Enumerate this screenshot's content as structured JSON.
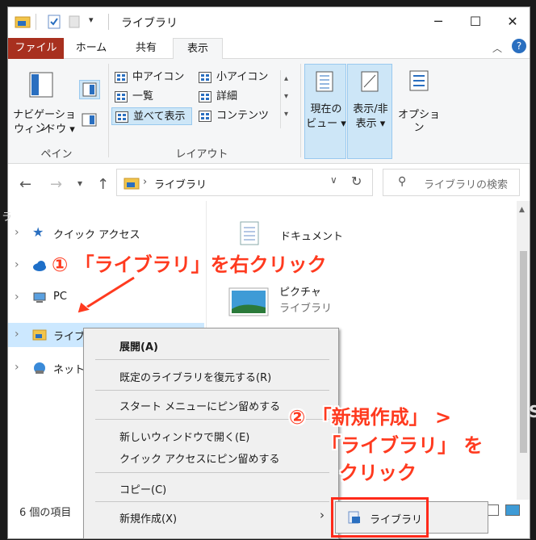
{
  "window": {
    "title": "ライブラリ",
    "controls": {
      "minimize": "─",
      "maximize": "☐",
      "close": "✕"
    }
  },
  "ribbon_tabs": {
    "file": "ファイル",
    "home": "ホーム",
    "share": "共有",
    "view": "表示"
  },
  "ribbon": {
    "nav_pane_label_1": "ナビゲーション",
    "nav_pane_label_2": "ウィンドウ ▾",
    "group_pane": "ペイン",
    "group_layout": "レイアウト",
    "layout_items": [
      "中アイコン",
      "小アイコン",
      "一覧",
      "詳細",
      "並べて表示",
      "コンテンツ"
    ],
    "current_view_1": "現在の",
    "current_view_2": "ビュー ▾",
    "show_hide_1": "表示/非",
    "show_hide_2": "表示 ▾",
    "options": "オプション"
  },
  "address": {
    "path": "ライブラリ",
    "search_placeholder": "ライブラリの検索"
  },
  "nav_pane": {
    "items": [
      "クイック アクセス",
      "",
      "PC",
      "ライブラリ",
      "ネットワ"
    ]
  },
  "content": {
    "items": [
      {
        "name": "ドキュメント",
        "sub": ""
      },
      {
        "name": "ピクチャ",
        "sub": "ライブラリ"
      }
    ]
  },
  "status": {
    "count": "6 個の項目"
  },
  "context_menu": {
    "items": [
      "展開(A)",
      "既定のライブラリを復元する(R)",
      "スタート メニューにピン留めする",
      "新しいウィンドウで開く(E)",
      "クイック アクセスにピン留めする",
      "コピー(C)",
      "新規作成(X)"
    ],
    "submenu_item": "ライブラリ"
  },
  "annotations": {
    "step1": "① 「ライブラリ」を右クリック",
    "step2_line1": "② 「新規作成」 >",
    "step2_line2": "「ライブラリ」 を",
    "step2_line3": "クリック"
  },
  "colors": {
    "file_tab": "#a8301f",
    "annotation": "#ff3a1f",
    "selection": "#cce8ff"
  }
}
